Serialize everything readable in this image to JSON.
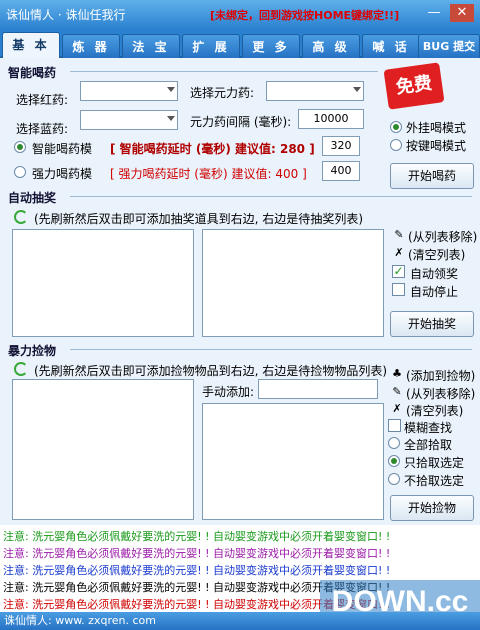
{
  "window": {
    "title": "诛仙情人 · 诛仙任我行",
    "warning": "[未绑定，回到游戏按HOME键绑定!!]",
    "minimize_glyph": "—",
    "close_glyph": "✕"
  },
  "tabs": [
    "基 本",
    "炼 器",
    "法 宝",
    "扩 展",
    "更 多",
    "高 级",
    "喊 话",
    "BUG 提交"
  ],
  "potion": {
    "section_title": "智能喝药",
    "red_label": "选择红药:",
    "blue_label": "选择蓝药:",
    "mana_label": "选择元力药:",
    "interval_label": "元力药间隔 (毫秒):",
    "interval_value": "10000",
    "smart_mode_label": "智能喝药模",
    "smart_hint": "[ 智能喝药延时 (毫秒) 建议值: 280 ]",
    "smart_value": "320",
    "force_mode_label": "强力喝药模",
    "force_hint": "[ 强力喝药延时 (毫秒) 建议值: 400 ]",
    "force_value": "400",
    "plugin_mode_label": "外挂喝模式",
    "key_mode_label": "按键喝模式",
    "start_button": "开始喝药",
    "free_badge": "免费"
  },
  "lottery": {
    "section_title": "自动抽奖",
    "instruction": "(先刷新然后双击即可添加抽奖道具到右边, 右边是待抽奖列表)",
    "remove_label": "(从列表移除)",
    "clear_label": "(清空列表)",
    "auto_claim_label": "自动领奖",
    "auto_stop_label": "自动停止",
    "start_button": "开始抽奖"
  },
  "pickup": {
    "section_title": "暴力捡物",
    "instruction": "(先刷新然后双击即可添加捡物物品到右边, 右边是待捡物物品列表)",
    "manual_label": "手动添加:",
    "add_label": "(添加到捡物)",
    "remove_label": "(从列表移除)",
    "clear_label": "(清空列表)",
    "fuzzy_label": "模糊查找",
    "pick_all_label": "全部拾取",
    "pick_selected_label": "只拾取选定",
    "pick_unselected_label": "不拾取选定",
    "start_button": "开始捡物"
  },
  "notices": [
    {
      "text": "注意: 洗元婴角色必须佩戴好要洗的元婴! !  自动婴变游戏中必须开着婴变窗口! !",
      "color": "#1a9a1a"
    },
    {
      "text": "注意: 洗元婴角色必须佩戴好要洗的元婴! !  自动婴变游戏中必须开着婴变窗口! !",
      "color": "#9b1ba9"
    },
    {
      "text": "注意: 洗元婴角色必须佩戴好要洗的元婴! !  自动婴变游戏中必须开着婴变窗口! !",
      "color": "#1a3ad0"
    },
    {
      "text": "注意: 洗元婴角色必须佩戴好要洗的元婴! !  自动婴变游戏中必须开着婴变窗口! !",
      "color": "#000000"
    },
    {
      "text": "注意: 洗元婴角色必须佩戴好要洗的元婴! !  自动婴变游戏中必须开着婴变窗口! !",
      "color": "#d00000"
    }
  ],
  "status": "诛仙情人: www. zxqren. com",
  "watermark": "DOWN.cc"
}
